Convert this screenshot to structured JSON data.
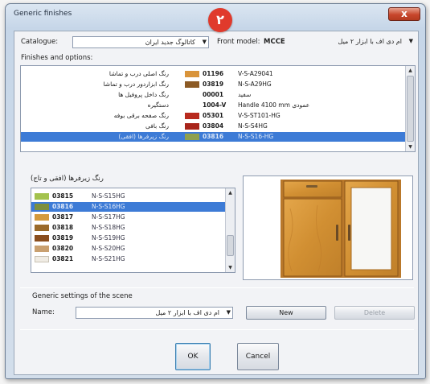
{
  "window": {
    "title": "Generic finishes",
    "close": "x"
  },
  "step_badge": "٢",
  "catalogue": {
    "label": "Catalogue:",
    "value": "کاتالوگ جدید ایران"
  },
  "front_model": {
    "label": "Front model:",
    "code": "MCCE",
    "value": "ام دی اف با ابزار ۲ میل"
  },
  "finishes": {
    "label": "Finishes and options:",
    "rows": [
      {
        "name": "رنگ اصلی درب و تماشا",
        "swatch": "#d9943a",
        "code": "01196",
        "desc": "V-S-A29041"
      },
      {
        "name": "رنگ ابزاردور درب و تماشا",
        "swatch": "#8c5a24",
        "code": "03819",
        "desc": "N-S-A29HG"
      },
      {
        "name": "رنگ داخل پروفیل ها",
        "swatch": "",
        "code": "00001",
        "desc": "سفید"
      },
      {
        "name": "دستگیره",
        "swatch": "",
        "code": "1004-V",
        "desc": "Handle 4100 mm عمودی"
      },
      {
        "name": "رنگ صفحه برقی بوفه",
        "swatch": "#b82a1e",
        "code": "05301",
        "desc": "V-S-ST101-HG"
      },
      {
        "name": "رنگ بافی",
        "swatch": "#a8241a",
        "code": "03804",
        "desc": "N-S-S4HG"
      },
      {
        "name": "رنگ زیرفرها (افقی)",
        "swatch": "#8ea04e",
        "code": "03816",
        "desc": "N-S-S16-HG",
        "selected": true
      }
    ]
  },
  "variants": {
    "label": "رنگ زیرفرها (افقی و تاج)",
    "rows": [
      {
        "swatch": "#a3c24d",
        "code": "03815",
        "desc": "N-S-S15HG"
      },
      {
        "swatch": "#7d8f3e",
        "code": "03816",
        "desc": "N-S-S16HG",
        "selected": true
      },
      {
        "swatch": "#d49a3c",
        "code": "03817",
        "desc": "N-S-S17HG"
      },
      {
        "swatch": "#9a6a2a",
        "code": "03818",
        "desc": "N-S-S18HG"
      },
      {
        "swatch": "#8a4e1e",
        "code": "03819",
        "desc": "N-S-S19HG"
      },
      {
        "swatch": "#c9a070",
        "code": "03820",
        "desc": "N-S-S20HG"
      },
      {
        "swatch": "#f0ece4",
        "code": "03821",
        "desc": "N-S-S21HG"
      }
    ]
  },
  "generic_settings": {
    "label": "Generic settings of the scene",
    "name_label": "Name:",
    "name_value": "ام دی اف با ابزار ۲ میل"
  },
  "buttons": {
    "new": "New",
    "delete": "Delete",
    "ok": "OK",
    "cancel": "Cancel"
  },
  "colors": {
    "selection": "#3d7bd6",
    "badge": "#e03a2c",
    "cabinet_wood": "#d89a3c"
  }
}
